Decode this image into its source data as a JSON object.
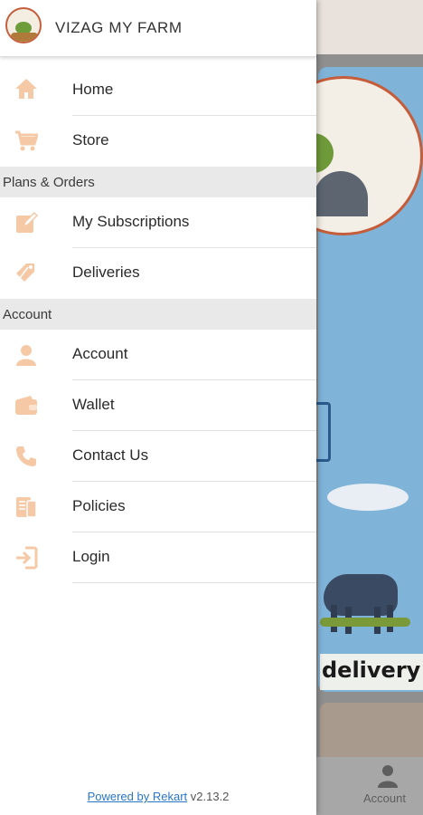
{
  "app": {
    "brand_title": "VIZAG MY FARM",
    "logo_name": "vizag-my-farm-logo",
    "accent_color": "#f6c9a6"
  },
  "menu": {
    "main": [
      {
        "label": "Home",
        "icon": "home-icon"
      },
      {
        "label": "Store",
        "icon": "cart-icon"
      }
    ],
    "sections": [
      {
        "title": "Plans & Orders",
        "items": [
          {
            "label": "My Subscriptions",
            "icon": "edit-icon"
          },
          {
            "label": "Deliveries",
            "icon": "tags-icon"
          }
        ]
      },
      {
        "title": "Account",
        "items": [
          {
            "label": "Account",
            "icon": "user-icon"
          },
          {
            "label": "Wallet",
            "icon": "wallet-icon"
          },
          {
            "label": "Contact Us",
            "icon": "phone-icon"
          },
          {
            "label": "Policies",
            "icon": "document-icon"
          },
          {
            "label": "Login",
            "icon": "login-icon"
          }
        ]
      }
    ]
  },
  "footer": {
    "powered_by": "Powered by Rekart",
    "version": "v2.13.2"
  },
  "background": {
    "banner_text": "delivery",
    "bottom_nav_label": "Account"
  }
}
